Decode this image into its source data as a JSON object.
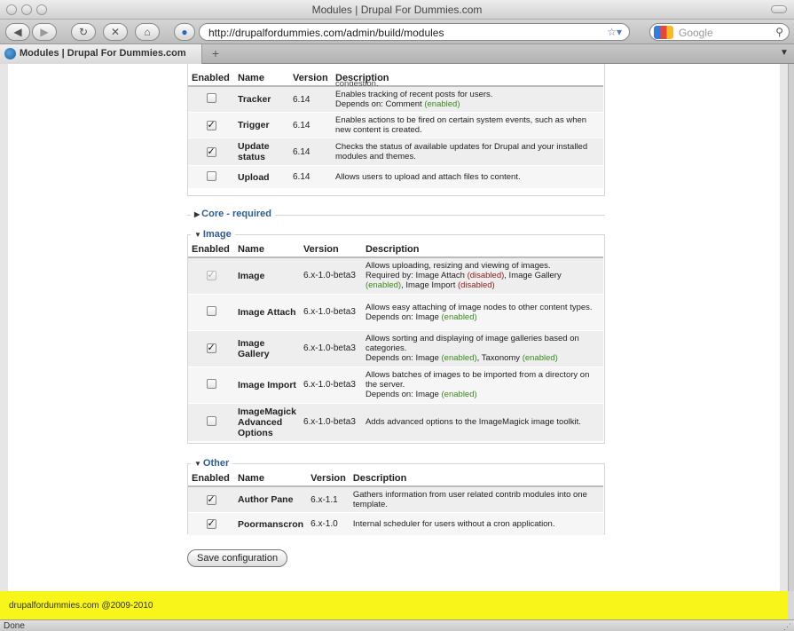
{
  "window": {
    "title": "Modules | Drupal For Dummies.com"
  },
  "toolbar": {
    "url": "http://drupalfordummies.com/admin/build/modules",
    "search_placeholder": "Google"
  },
  "tabs": [
    {
      "label": "Modules | Drupal For Dummies.com"
    }
  ],
  "headers": {
    "enabled": "Enabled",
    "name": "Name",
    "version": "Version",
    "description": "Description"
  },
  "top_section": {
    "clipped_text": "congestion.",
    "rows": [
      {
        "checked": false,
        "name": "Tracker",
        "version": "6.14",
        "desc": "Enables tracking of recent posts for users.",
        "dep_prefix": "Depends on: Comment",
        "dep_status": "(enabled)"
      },
      {
        "checked": true,
        "name": "Trigger",
        "version": "6.14",
        "desc": "Enables actions to be fired on certain system events, such as when new content is created."
      },
      {
        "checked": true,
        "name": "Update status",
        "version": "6.14",
        "desc": "Checks the status of available updates for Drupal and your installed modules and themes."
      },
      {
        "checked": false,
        "name": "Upload",
        "version": "6.14",
        "desc": "Allows users to upload and attach files to content."
      }
    ]
  },
  "core_required": {
    "legend": "Core - required",
    "collapsed": true
  },
  "image_section": {
    "legend": "Image",
    "rows": [
      {
        "checked": true,
        "disabled": true,
        "name": "Image",
        "version": "6.x-1.0-beta3",
        "desc": "Allows uploading, resizing and viewing of images.",
        "req_prefix": "Required by: Image Attach",
        "req_s1": "(disabled)",
        "req_mid": ", Image Gallery",
        "req_s2": "(enabled)",
        "req_mid2": ", Image Import",
        "req_s3": "(disabled)"
      },
      {
        "checked": false,
        "name": "Image Attach",
        "version": "6.x-1.0-beta3",
        "desc": "Allows easy attaching of image nodes to other content types.",
        "dep_prefix": "Depends on: Image",
        "dep_status": "(enabled)"
      },
      {
        "checked": true,
        "name": "Image Gallery",
        "version": "6.x-1.0-beta3",
        "desc": "Allows sorting and displaying of image galleries based on categories.",
        "dep_prefix": "Depends on: Image",
        "dep_status": "(enabled)",
        "dep_mid": ", Taxonomy",
        "dep_status2": "(enabled)"
      },
      {
        "checked": false,
        "name": "Image Import",
        "version": "6.x-1.0-beta3",
        "desc": "Allows batches of images to be imported from a directory on the server.",
        "dep_prefix": "Depends on: Image",
        "dep_status": "(enabled)"
      },
      {
        "checked": false,
        "name": "ImageMagick Advanced Options",
        "version": "6.x-1.0-beta3",
        "desc": "Adds advanced options to the ImageMagick image toolkit."
      }
    ]
  },
  "other_section": {
    "legend": "Other",
    "rows": [
      {
        "checked": true,
        "name": "Author Pane",
        "version": "6.x-1.1",
        "desc": "Gathers information from user related contrib modules into one template."
      },
      {
        "checked": true,
        "name": "Poormanscron",
        "version": "6.x-1.0",
        "desc": "Internal scheduler for users without a cron application."
      }
    ]
  },
  "save_button": "Save configuration",
  "footer": {
    "text": "drupalfordummies.com @2009-2010"
  },
  "status": {
    "text": "Done"
  },
  "colors": {
    "footer_bg": "#f7f51a",
    "enabled": "#3a8a1e",
    "disabled": "#8b1a1a",
    "legend": "#2d5d8a"
  }
}
